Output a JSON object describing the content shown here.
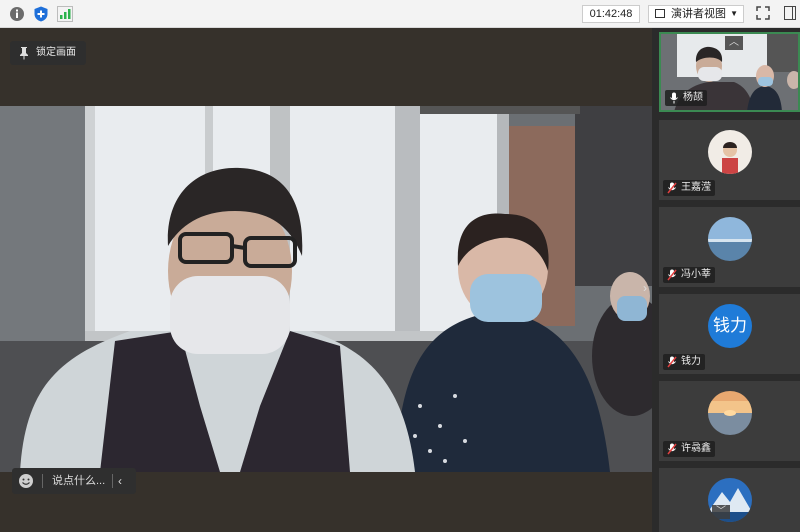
{
  "toolbar": {
    "timer": "01:42:48",
    "view_mode": "演讲者视图",
    "icons": [
      "info-icon",
      "shield-icon",
      "signal-icon"
    ]
  },
  "stage": {
    "lock_label": "锁定画面",
    "chat_placeholder": "说点什么..."
  },
  "participants": [
    {
      "name": "杨颉",
      "mic": "on",
      "type": "video",
      "active": true
    },
    {
      "name": "王嘉滢",
      "mic": "muted",
      "type": "photo"
    },
    {
      "name": "冯小莘",
      "mic": "muted",
      "type": "photo"
    },
    {
      "name": "钱力",
      "mic": "muted",
      "type": "text",
      "avatar_text": "钱力",
      "avatar_color": "#1f7bd8"
    },
    {
      "name": "许骉鑫",
      "mic": "muted",
      "type": "photo"
    },
    {
      "name": "",
      "mic": "muted",
      "type": "photo"
    }
  ]
}
